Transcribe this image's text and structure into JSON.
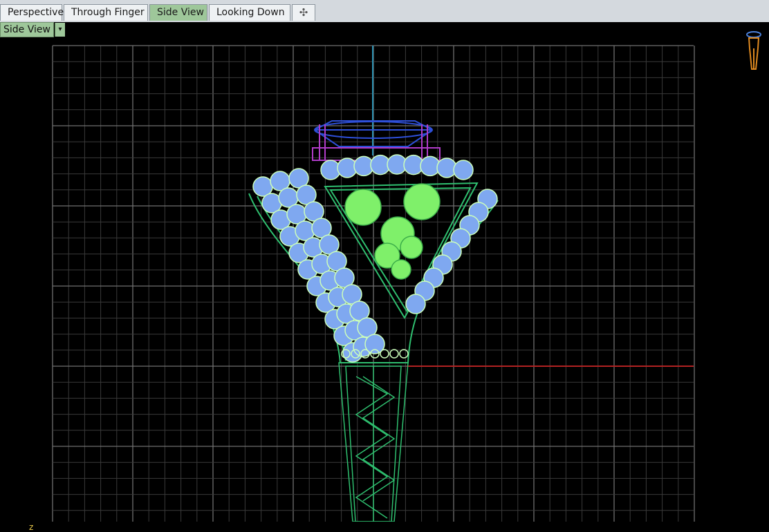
{
  "tabs": [
    {
      "label": "Perspective",
      "active": false
    },
    {
      "label": "Through Finger",
      "active": false
    },
    {
      "label": "Side View",
      "active": true
    },
    {
      "label": "Looking Down",
      "active": false
    }
  ],
  "add_tab_glyph": "✣",
  "viewport": {
    "label": "Side View",
    "dropdown_glyph": "▾",
    "axis_indicator": "z"
  },
  "colors": {
    "background": "#000000",
    "grid_minor": "#3a3a3a",
    "grid_major": "#707070",
    "axis_x": "#b22222",
    "axis_z": "#2a8fb0",
    "gem_blue": "#7fa8f0",
    "gem_green": "#7ff06a",
    "wire_green": "#2fbf6f",
    "setting_purple": "#b03cc8",
    "setting_blue": "#2e4fd8",
    "tab_active": "#9ec79a"
  }
}
